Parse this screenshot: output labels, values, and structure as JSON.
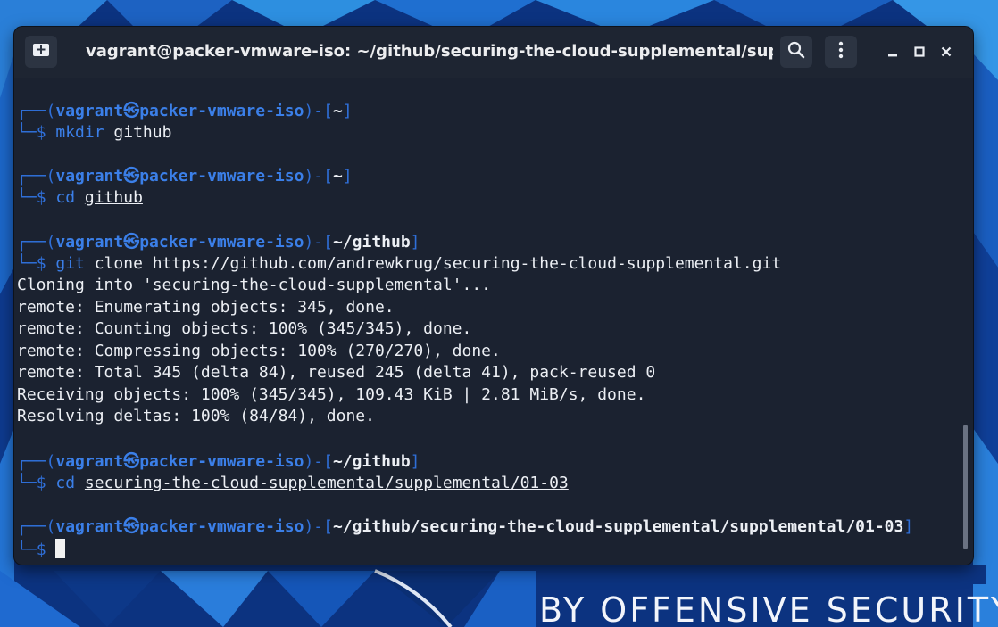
{
  "window": {
    "title": "vagrant@packer-vmware-iso: ~/github/securing-the-cloud-supplemental/supple...",
    "controls": {
      "new_tab_icon": "new-tab-icon",
      "search_icon": "search-icon",
      "menu_icon": "kebab-menu-icon",
      "minimize_icon": "minimize-icon",
      "maximize_icon": "maximize-icon",
      "close_icon": "close-icon"
    }
  },
  "wallpaper": {
    "brand_text": "BY OFFENSIVE SECURITY"
  },
  "prompt": {
    "user": "vagrant",
    "at_symbol": "㉿",
    "host": "packer-vmware-iso",
    "dollar": "$"
  },
  "blocks": [
    {
      "cwd": "~",
      "command": "mkdir",
      "args": "github",
      "args_underlined": false
    },
    {
      "cwd": "~",
      "command": "cd",
      "args": "github",
      "args_underlined": true
    },
    {
      "cwd": "~/github",
      "command": "git",
      "args": "clone https://github.com/andrewkrug/securing-the-cloud-supplemental.git",
      "args_underlined": false
    },
    {
      "cwd": "~/github",
      "command": "cd",
      "args": "securing-the-cloud-supplemental/supplemental/01-03",
      "args_underlined": true
    },
    {
      "cwd": "~/github/securing-the-cloud-supplemental/supplemental/01-03",
      "command": "",
      "args": "",
      "args_underlined": false
    }
  ],
  "output": [
    "Cloning into 'securing-the-cloud-supplemental'...",
    "remote: Enumerating objects: 345, done.",
    "remote: Counting objects: 100% (345/345), done.",
    "remote: Compressing objects: 100% (270/270), done.",
    "remote: Total 345 (delta 84), reused 245 (delta 41), pack-reused 0",
    "Receiving objects: 100% (345/345), 109.43 KiB | 2.81 MiB/s, done.",
    "Resolving deltas: 100% (84/84), done."
  ],
  "colors": {
    "prompt_frame": "#2f6fd8",
    "user_host": "#3b7fe8",
    "background": "#1b2230",
    "text": "#eceff4"
  }
}
